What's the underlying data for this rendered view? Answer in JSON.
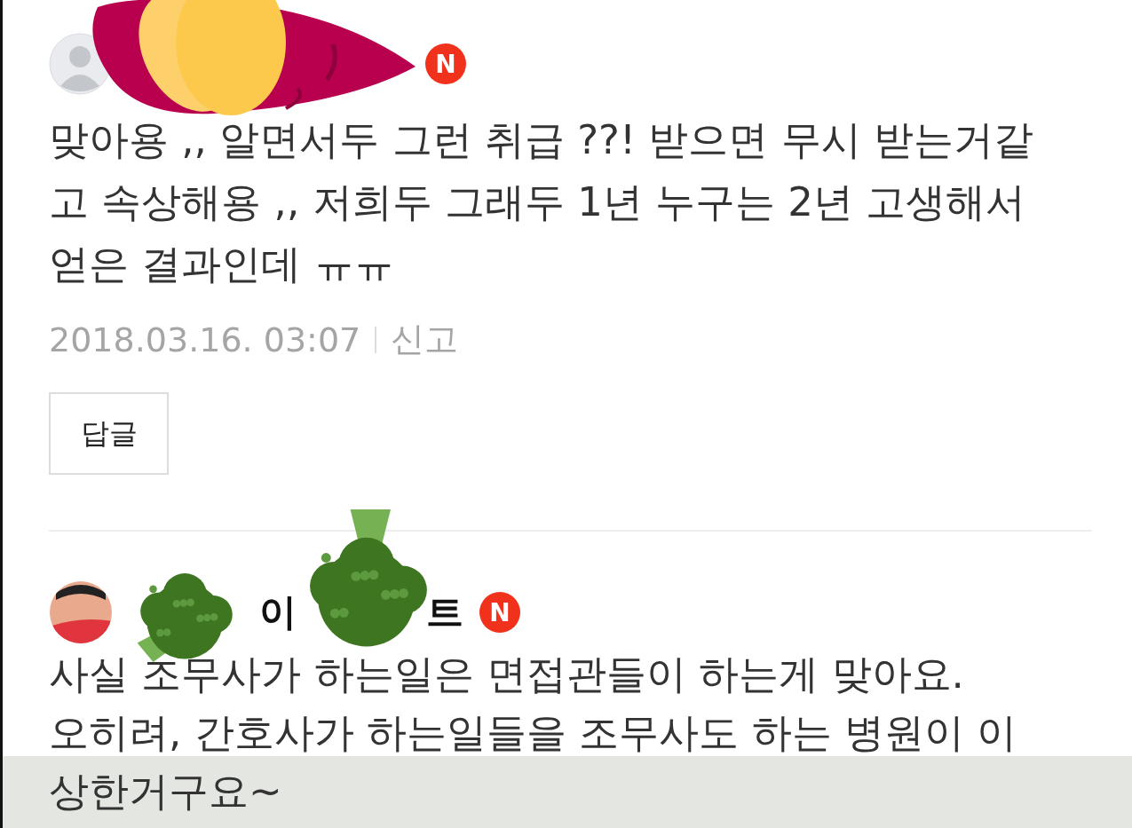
{
  "comments": [
    {
      "avatar": {
        "kind": "silhouette"
      },
      "badge": "N",
      "sticker": {
        "kind": "sweet_potato"
      },
      "body_lines": [
        "맞아용 ,, 알면서두 그런 취급 ??! 받으면 무시 받는거같",
        "고 속상해용 ,, 저희두 그래두 1년 누구는 2년 고생해서",
        "얻은 결과인데 ㅠㅠ"
      ],
      "date": "2018.03.16. 03:07",
      "report": "신고",
      "reply": "답글"
    },
    {
      "avatar": {
        "kind": "cartoon"
      },
      "name_fragments": [
        "이",
        "트"
      ],
      "badge": "N",
      "sticker": {
        "kind": "broccoli_pair"
      },
      "body_lines": [
        "사실 조무사가 하는일은 면접관들이 하는게 맞아요.",
        "오히려, 간호사가 하는일들을 조무사도 하는 병원이 이",
        "상한거구요~"
      ]
    }
  ]
}
